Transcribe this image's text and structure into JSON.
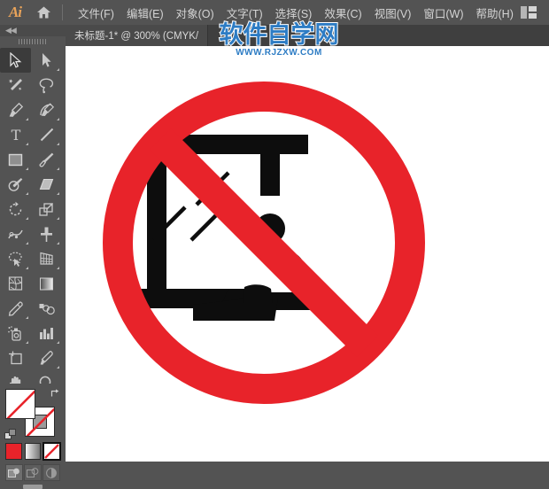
{
  "app": {
    "name": "Ai",
    "logo_color": "#e8a35a",
    "chrome_bg": "#535353"
  },
  "menubar": {
    "logo_label": "Ai",
    "home_icon": "home-icon",
    "workspace_icon": "workspace-switcher-icon",
    "items": [
      {
        "label": "文件(F)",
        "name": "menu-file"
      },
      {
        "label": "编辑(E)",
        "name": "menu-edit"
      },
      {
        "label": "对象(O)",
        "name": "menu-object"
      },
      {
        "label": "文字(T)",
        "name": "menu-type"
      },
      {
        "label": "选择(S)",
        "name": "menu-select"
      },
      {
        "label": "效果(C)",
        "name": "menu-effect"
      },
      {
        "label": "视图(V)",
        "name": "menu-view"
      },
      {
        "label": "窗口(W)",
        "name": "menu-window"
      },
      {
        "label": "帮助(H)",
        "name": "menu-help"
      }
    ]
  },
  "document_tab": {
    "title": "未标题-1* @ 300% (CMYK/",
    "close_icon": "close-icon"
  },
  "toolbar": {
    "collapse_label": "◀◀",
    "tools": [
      {
        "name": "selection-tool",
        "icon": "arrow-solid-icon",
        "selected": true,
        "corner": false
      },
      {
        "name": "direct-selection-tool",
        "icon": "arrow-hollow-icon",
        "selected": false,
        "corner": true
      },
      {
        "name": "magic-wand-tool",
        "icon": "magic-wand-icon",
        "selected": false,
        "corner": false
      },
      {
        "name": "lasso-tool",
        "icon": "lasso-icon",
        "selected": false,
        "corner": false
      },
      {
        "name": "pen-tool",
        "icon": "pen-icon",
        "selected": false,
        "corner": true
      },
      {
        "name": "curvature-tool",
        "icon": "curvature-icon",
        "selected": false,
        "corner": true
      },
      {
        "name": "type-tool",
        "icon": "type-t-icon",
        "selected": false,
        "corner": true
      },
      {
        "name": "line-segment-tool",
        "icon": "line-segment-icon",
        "selected": false,
        "corner": true
      },
      {
        "name": "rectangle-tool",
        "icon": "rectangle-icon",
        "selected": false,
        "corner": true
      },
      {
        "name": "paintbrush-tool",
        "icon": "paintbrush-icon",
        "selected": false,
        "corner": true
      },
      {
        "name": "shaper-tool",
        "icon": "shaper-pencil-icon",
        "selected": false,
        "corner": true
      },
      {
        "name": "eraser-tool",
        "icon": "eraser-icon",
        "selected": false,
        "corner": true
      },
      {
        "name": "rotate-tool",
        "icon": "rotate-icon",
        "selected": false,
        "corner": true
      },
      {
        "name": "scale-tool",
        "icon": "scale-icon",
        "selected": false,
        "corner": true
      },
      {
        "name": "width-tool",
        "icon": "width-warp-icon",
        "selected": false,
        "corner": true
      },
      {
        "name": "free-transform-tool",
        "icon": "pushpin-icon",
        "selected": false,
        "corner": true
      },
      {
        "name": "shape-builder-tool",
        "icon": "shape-builder-icon",
        "selected": false,
        "corner": true
      },
      {
        "name": "perspective-grid-tool",
        "icon": "perspective-grid-icon",
        "selected": false,
        "corner": true
      },
      {
        "name": "mesh-tool",
        "icon": "mesh-icon",
        "selected": false,
        "corner": false
      },
      {
        "name": "gradient-tool",
        "icon": "gradient-icon",
        "selected": false,
        "corner": false
      },
      {
        "name": "eyedropper-tool",
        "icon": "eyedropper-icon",
        "selected": false,
        "corner": true
      },
      {
        "name": "blend-tool",
        "icon": "blend-icon",
        "selected": false,
        "corner": false
      },
      {
        "name": "symbol-sprayer-tool",
        "icon": "symbol-sprayer-icon",
        "selected": false,
        "corner": true
      },
      {
        "name": "column-graph-tool",
        "icon": "bar-chart-icon",
        "selected": false,
        "corner": true
      },
      {
        "name": "artboard-tool",
        "icon": "artboard-icon",
        "selected": false,
        "corner": false
      },
      {
        "name": "slice-tool",
        "icon": "slice-knife-icon",
        "selected": false,
        "corner": true
      },
      {
        "name": "hand-tool",
        "icon": "hand-icon",
        "selected": false,
        "corner": true
      },
      {
        "name": "zoom-tool",
        "icon": "magnifier-icon",
        "selected": false,
        "corner": false
      }
    ],
    "fill_stroke": {
      "fill_name": "fill-swatch",
      "fill_value": "none",
      "stroke_name": "stroke-swatch",
      "stroke_value": "none",
      "swap_icon": "swap-fill-stroke-icon",
      "default_icon": "default-fill-stroke-icon",
      "none_slash_color": "#e8232a"
    },
    "color_modes": [
      {
        "name": "color-swatch-button",
        "icon": "solid-color-icon",
        "color": "#e8232a",
        "active": false
      },
      {
        "name": "gradient-swatch-button",
        "icon": "gradient-icon",
        "color": "#cccccc",
        "active": false
      },
      {
        "name": "none-swatch-button",
        "icon": "none-slash-icon",
        "color": "#ffffff",
        "active": true
      }
    ],
    "draw_modes": [
      {
        "name": "draw-normal-button",
        "icon": "draw-normal-icon",
        "active": true
      },
      {
        "name": "draw-behind-button",
        "icon": "draw-behind-icon",
        "active": false
      },
      {
        "name": "draw-inside-button",
        "icon": "draw-inside-icon",
        "active": false
      }
    ]
  },
  "artwork": {
    "name": "no-leaning-prohibition-sign",
    "description": "红色禁止标志：禁止倚靠/坐在玻璃结构上",
    "ring_color": "#e8232a",
    "pictogram_color": "#0d0d0d",
    "background_color": "#ffffff"
  },
  "watermark": {
    "chinese": "软件自学网",
    "url": "WWW.RJZXW.COM",
    "color": "#2d7cc4",
    "outline": "#ffffff"
  }
}
